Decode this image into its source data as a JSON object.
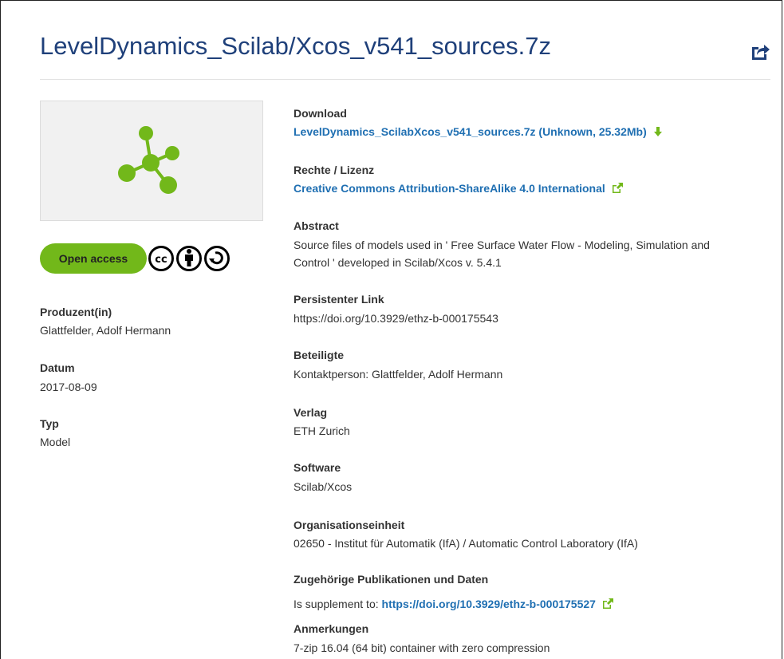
{
  "title": "LevelDynamics_Scilab/Xcos_v541_sources.7z",
  "share_icon": "share-icon",
  "thumbnail_icon": "dataset-molecule-icon",
  "access": {
    "label": "Open access",
    "license_icon": "cc-by-sa-icon"
  },
  "left": {
    "producer_label": "Produzent(in)",
    "producer": "Glattfelder, Adolf Hermann",
    "date_label": "Datum",
    "date": "2017-08-09",
    "type_label": "Typ",
    "type": "Model"
  },
  "right": {
    "download_label": "Download",
    "download_link": "LevelDynamics_ScilabXcos_v541_sources.7z (Unknown, 25.32Mb)",
    "rights_label": "Rechte / Lizenz",
    "rights_link": "Creative Commons Attribution-ShareAlike 4.0 International",
    "abstract_label": "Abstract",
    "abstract_line1": "Source files of models used in ' Free Surface Water Flow - Modeling, Simulation and",
    "abstract_line2": "Control ' developed in Scilab/Xcos v. 5.4.1",
    "persistent_label": "Persistenter Link",
    "persistent_value": "https://doi.org/10.3929/ethz-b-000175543",
    "contributors_label": "Beteiligte",
    "contributors_value": "Kontaktperson: Glattfelder, Adolf Hermann",
    "publisher_label": "Verlag",
    "publisher_value": "ETH Zurich",
    "software_label": "Software",
    "software_value": "Scilab/Xcos",
    "org_label": "Organisationseinheit",
    "org_value": "02650 - Institut für Automatik (IfA) / Automatic Control Laboratory (IfA)",
    "related_label": "Zugehörige Publikationen und Daten",
    "related_prefix": "Is supplement to:",
    "related_link": "https://doi.org/10.3929/ethz-b-000175527",
    "notes_label": "Anmerkungen",
    "notes_value": "7-zip 16.04 (64 bit) container with zero compression"
  },
  "colors": {
    "title": "#1f407a",
    "link": "#1f6fb2",
    "accent_green": "#72b81a"
  }
}
